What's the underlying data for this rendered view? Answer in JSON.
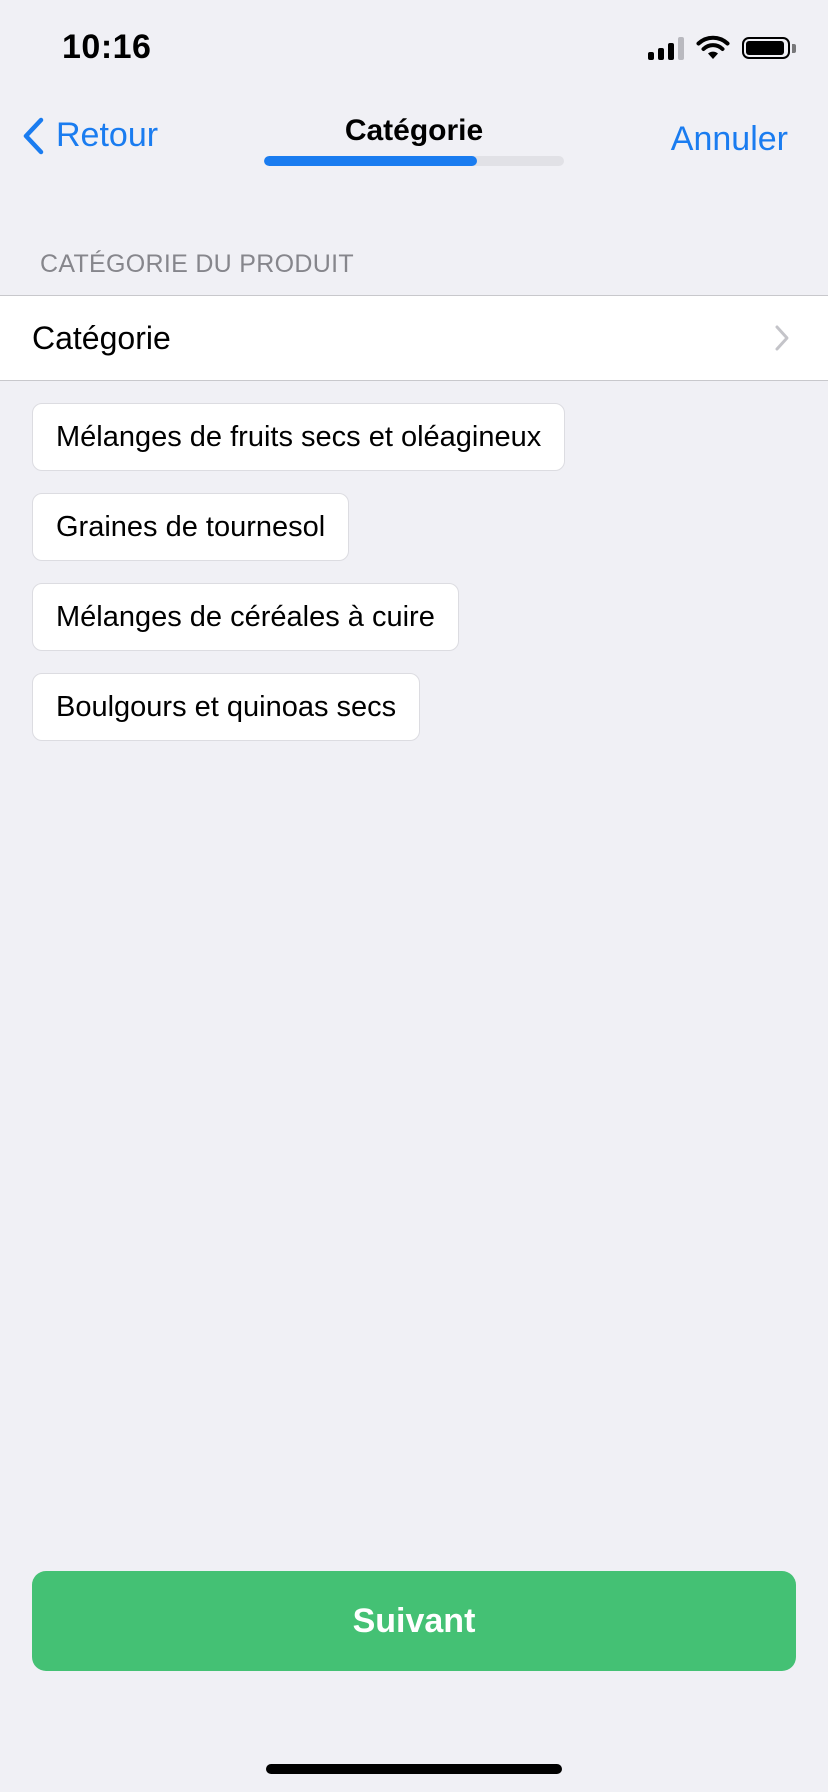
{
  "status_bar": {
    "time": "10:16",
    "icons": [
      "signal-icon",
      "wifi-icon",
      "battery-icon"
    ]
  },
  "nav": {
    "back_label": "Retour",
    "title": "Catégorie",
    "cancel_label": "Annuler",
    "progress_percent": 71
  },
  "section": {
    "header": "CATÉGORIE DU PRODUIT",
    "row_label": "Catégorie"
  },
  "suggestions": [
    {
      "label": "Mélanges de fruits secs et oléagineux"
    },
    {
      "label": "Graines de tournesol"
    },
    {
      "label": "Mélanges de céréales à cuire"
    },
    {
      "label": "Boulgours et quinoas secs"
    }
  ],
  "footer": {
    "next_label": "Suivant"
  },
  "colors": {
    "accent": "#1A7CF0",
    "background": "#F0F0F5",
    "next_button": "#44C174",
    "secondary_text": "#86868C"
  }
}
